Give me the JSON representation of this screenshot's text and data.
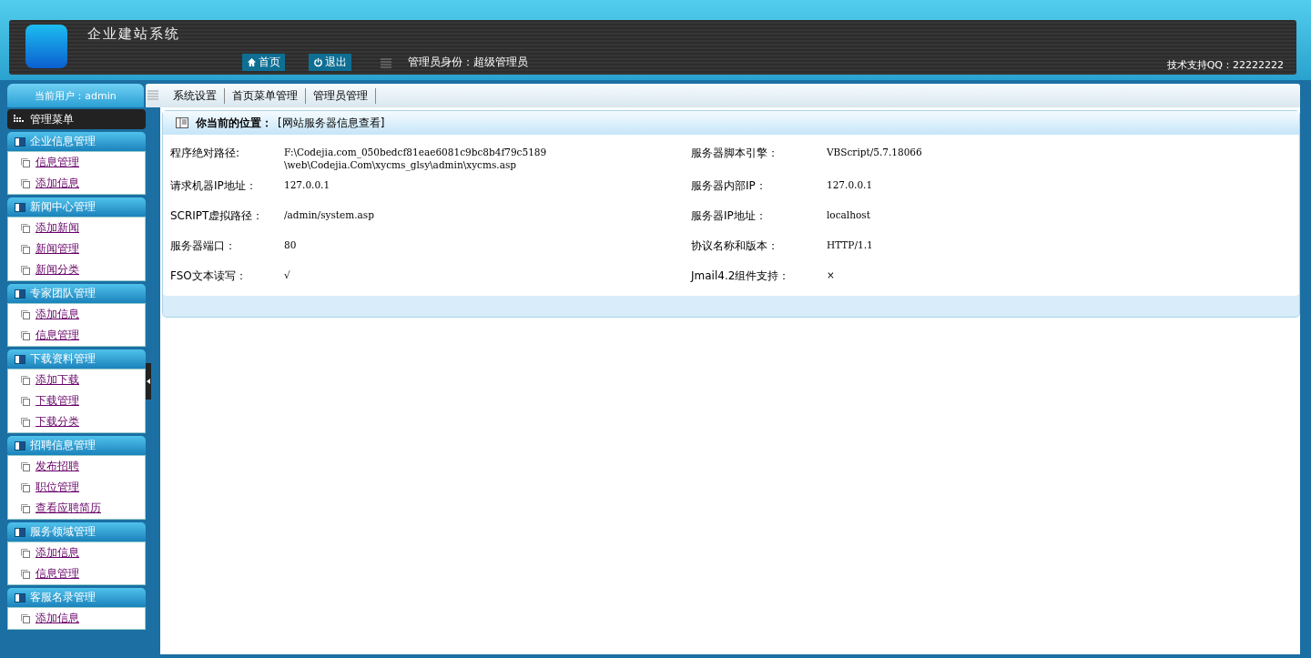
{
  "header": {
    "site_title": "企业建站系统",
    "home_button": "首页",
    "logout_button": "退出",
    "admin_role": "管理员身份：超级管理员",
    "support": "技术支持QQ：22222222"
  },
  "nav": {
    "current_user": "当前用户：admin",
    "tabs": [
      {
        "label": "系统设置"
      },
      {
        "label": "首页菜单管理"
      },
      {
        "label": "管理员管理"
      }
    ]
  },
  "sidebar": {
    "title": "管理菜单",
    "groups": [
      {
        "title": "企业信息管理",
        "items": [
          "信息管理",
          "添加信息"
        ]
      },
      {
        "title": "新闻中心管理",
        "items": [
          "添加新闻",
          "新闻管理",
          "新闻分类"
        ]
      },
      {
        "title": "专家团队管理",
        "items": [
          "添加信息",
          "信息管理"
        ]
      },
      {
        "title": "下载资料管理",
        "items": [
          "添加下载",
          "下载管理",
          "下载分类"
        ]
      },
      {
        "title": "招聘信息管理",
        "items": [
          "发布招聘",
          "职位管理",
          "查看应聘简历"
        ]
      },
      {
        "title": "服务领域管理",
        "items": [
          "添加信息",
          "信息管理"
        ]
      },
      {
        "title": "客服名录管理",
        "items": [
          "添加信息"
        ]
      }
    ]
  },
  "panel": {
    "location_label": "你当前的位置：",
    "location": "[网站服务器信息查看]",
    "rows": [
      {
        "label": "程序绝对路径:",
        "value": "F:\\Codejia.com_050bedcf81eae6081c9bc8b4f79c5189\n\\web\\Codejia.Com\\xycms_glsy\\admin\\xycms.asp",
        "label2": "服务器脚本引擎：",
        "value2": "VBScript/5.7.18066"
      },
      {
        "label": "请求机器IP地址：",
        "value": "127.0.0.1",
        "label2": "服务器内部IP：",
        "value2": "127.0.0.1"
      },
      {
        "label": "SCRIPT虚拟路径：",
        "value": "/admin/system.asp",
        "label2": "服务器IP地址：",
        "value2": "localhost"
      },
      {
        "label": "服务器端口：",
        "value": "80",
        "label2": "协议名称和版本：",
        "value2": "HTTP/1.1"
      },
      {
        "label": "FSO文本读写：",
        "value": "√",
        "label2": "Jmail4.2组件支持：",
        "value2": "×"
      }
    ]
  }
}
